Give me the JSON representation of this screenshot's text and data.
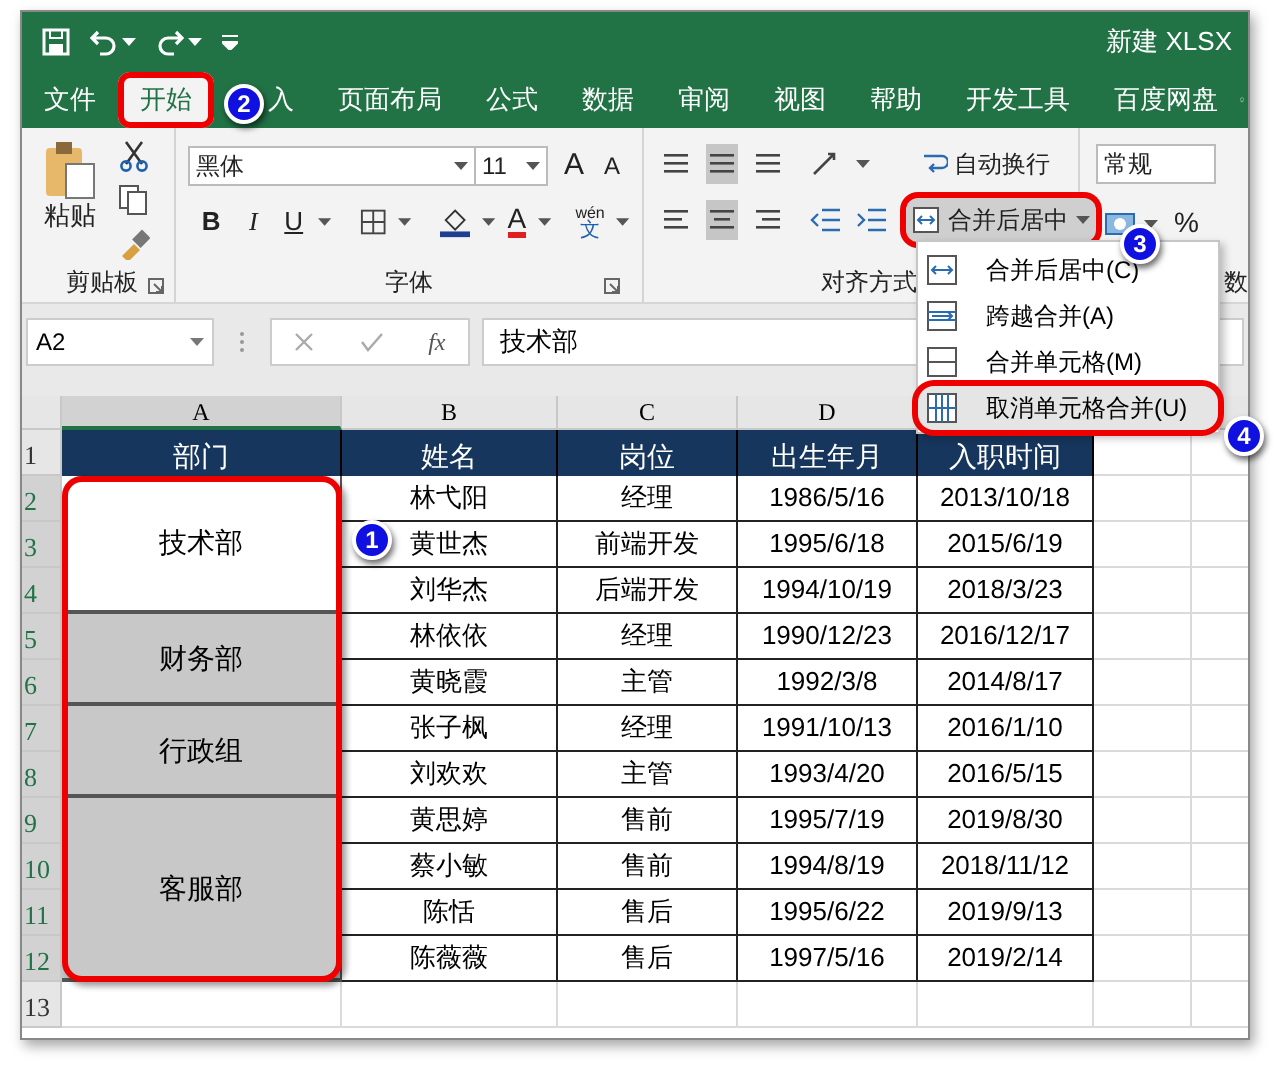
{
  "window": {
    "title": "新建 XLSX"
  },
  "ribbon_tabs": [
    {
      "label": "文件",
      "selected": false,
      "highlighted": false
    },
    {
      "label": "开始",
      "selected": true,
      "highlighted": true
    },
    {
      "label": "入",
      "selected": false,
      "highlighted": false
    },
    {
      "label": "页面布局",
      "selected": false,
      "highlighted": false
    },
    {
      "label": "公式",
      "selected": false,
      "highlighted": false
    },
    {
      "label": "数据",
      "selected": false,
      "highlighted": false
    },
    {
      "label": "审阅",
      "selected": false,
      "highlighted": false
    },
    {
      "label": "视图",
      "selected": false,
      "highlighted": false
    },
    {
      "label": "帮助",
      "selected": false,
      "highlighted": false
    },
    {
      "label": "开发工具",
      "selected": false,
      "highlighted": false
    },
    {
      "label": "百度网盘",
      "selected": false,
      "highlighted": false
    }
  ],
  "ribbon": {
    "clipboard": {
      "paste": "粘贴",
      "label": "剪贴板"
    },
    "font": {
      "name": "黑体",
      "size": "11",
      "grow": "A",
      "shrink": "A",
      "bold": "B",
      "italic": "I",
      "underline": "U",
      "font_color": "A",
      "phonetic": "wén",
      "phonetic_char": "文",
      "label": "字体"
    },
    "alignment": {
      "wrap_text": "自动换行",
      "merge_button": "合并后居中",
      "merge_highlighted": true,
      "label": "对齐方式"
    },
    "number": {
      "format": "常规",
      "percent": "%",
      "label": "数"
    }
  },
  "merge_menu": [
    {
      "label": "合并后居中(C)",
      "highlighted": false
    },
    {
      "label": "跨越合并(A)",
      "highlighted": false
    },
    {
      "label": "合并单元格(M)",
      "highlighted": false
    },
    {
      "label": "取消单元格合并(U)",
      "highlighted": true
    }
  ],
  "formula_bar": {
    "name_box": "A2",
    "fx": "fx",
    "formula": "技术部"
  },
  "sheet": {
    "columns": [
      "A",
      "B",
      "C",
      "D"
    ],
    "row_numbers": [
      "1",
      "2",
      "3",
      "4",
      "5",
      "6",
      "7",
      "8",
      "9",
      "10",
      "11",
      "12",
      "13"
    ],
    "header": [
      "部门",
      "姓名",
      "岗位",
      "出生年月",
      "入职时间"
    ],
    "departments_highlighted": true,
    "departments": [
      {
        "name": "技术部",
        "active": true,
        "employees": [
          {
            "name": "林弋阳",
            "position": "经理",
            "birth": "1986/5/16",
            "hired": "2013/10/18"
          },
          {
            "name": "黄世杰",
            "position": "前端开发",
            "birth": "1995/6/18",
            "hired": "2015/6/19"
          },
          {
            "name": "刘华杰",
            "position": "后端开发",
            "birth": "1994/10/19",
            "hired": "2018/3/23"
          }
        ]
      },
      {
        "name": "财务部",
        "active": false,
        "employees": [
          {
            "name": "林依依",
            "position": "经理",
            "birth": "1990/12/23",
            "hired": "2016/12/17"
          },
          {
            "name": "黄晓霞",
            "position": "主管",
            "birth": "1992/3/8",
            "hired": "2014/8/17"
          }
        ]
      },
      {
        "name": "行政组",
        "active": false,
        "employees": [
          {
            "name": "张子枫",
            "position": "经理",
            "birth": "1991/10/13",
            "hired": "2016/1/10"
          },
          {
            "name": "刘欢欢",
            "position": "主管",
            "birth": "1993/4/20",
            "hired": "2016/5/15"
          }
        ]
      },
      {
        "name": "客服部",
        "active": false,
        "employees": [
          {
            "name": "黄思婷",
            "position": "售前",
            "birth": "1995/7/19",
            "hired": "2019/8/30"
          },
          {
            "name": "蔡小敏",
            "position": "售前",
            "birth": "1994/8/19",
            "hired": "2018/11/12"
          },
          {
            "name": "陈恬",
            "position": "售后",
            "birth": "1995/6/22",
            "hired": "2019/9/13"
          },
          {
            "name": "陈薇薇",
            "position": "售后",
            "birth": "1997/5/16",
            "hired": "2019/2/14"
          }
        ]
      }
    ]
  },
  "callouts": [
    "1",
    "2",
    "3",
    "4"
  ]
}
